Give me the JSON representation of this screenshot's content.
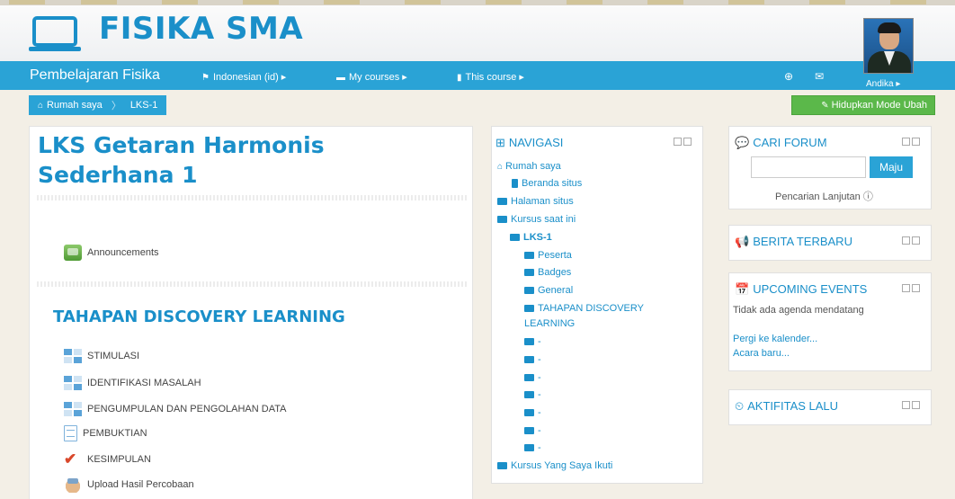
{
  "site": {
    "title": "FISIKA SMA",
    "brand": "Pembelajaran Fisika"
  },
  "nav": {
    "language": "Indonesian (id) ▸",
    "my_courses": "My courses ▸",
    "this_course": "This course ▸",
    "user": "Andika ▸"
  },
  "breadcrumb": {
    "home": "Rumah saya",
    "current": "LKS-1"
  },
  "edit_button": "Hidupkan Mode Ubah",
  "main": {
    "title": "LKS Getaran Harmonis Sederhana 1",
    "announcements": "Announcements",
    "section_title": "TAHAPAN DISCOVERY LEARNING",
    "activities": [
      {
        "label": "STIMULASI",
        "icon": "lesson-icon"
      },
      {
        "label": "IDENTIFIKASI MASALAH",
        "icon": "lesson-icon"
      },
      {
        "label": "PENGUMPULAN DAN PENGOLAHAN DATA",
        "icon": "lesson-icon"
      },
      {
        "label": "PEMBUKTIAN",
        "icon": "page-icon"
      },
      {
        "label": "KESIMPULAN",
        "icon": "check-icon"
      },
      {
        "label": "Upload Hasil Percobaan",
        "icon": "upload-icon"
      }
    ]
  },
  "navigasi": {
    "title": "NAVIGASI",
    "items": [
      {
        "label": "Rumah saya"
      },
      {
        "label": "Beranda situs"
      },
      {
        "label": "Halaman situs"
      },
      {
        "label": "Kursus saat ini"
      },
      {
        "label": "LKS-1"
      },
      {
        "label": "Peserta"
      },
      {
        "label": "Badges"
      },
      {
        "label": "General"
      },
      {
        "label": "TAHAPAN DISCOVERY"
      },
      {
        "label": "LEARNING"
      },
      {
        "label": "-"
      },
      {
        "label": "-"
      },
      {
        "label": "-"
      },
      {
        "label": "-"
      },
      {
        "label": "-"
      },
      {
        "label": "-"
      },
      {
        "label": "-"
      },
      {
        "label": "Kursus Yang Saya Ikuti"
      }
    ]
  },
  "forum": {
    "title": "CARI FORUM",
    "button": "Maju",
    "advanced": "Pencarian Lanjutan"
  },
  "news": {
    "title": "BERITA TERBARU"
  },
  "events": {
    "title": "UPCOMING EVENTS",
    "empty": "Tidak ada agenda mendatang",
    "calendar": "Pergi ke kalender...",
    "new_event": "Acara baru..."
  },
  "activity": {
    "title": "AKTIFITAS LALU"
  },
  "colors": {
    "accent": "#2aa3d6",
    "title": "#1a8fc9",
    "edit": "#5bb84a"
  }
}
